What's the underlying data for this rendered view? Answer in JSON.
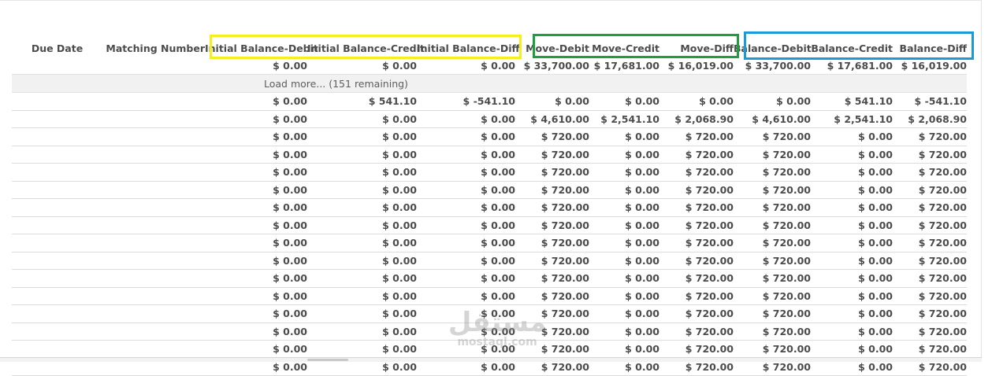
{
  "columns": {
    "due_date": "Due Date",
    "matching_number": "Matching Number",
    "initial_debit": "Initial Balance-Debit",
    "initial_credit": "Initial Balance-Credit",
    "initial_diff": "Initial Balance-Diff",
    "move_debit": "Move-Debit",
    "move_credit": "Move-Credit",
    "move_diff": "Move-Diff",
    "balance_debit": "Balance-Debit",
    "balance_credit": "Balance-Credit",
    "balance_diff": "Balance-Diff"
  },
  "totals": [
    "$ 0.00",
    "$ 0.00",
    "$ 0.00",
    "$ 33,700.00",
    "$ 17,681.00",
    "$ 16,019.00",
    "$ 33,700.00",
    "$ 17,681.00",
    "$ 16,019.00"
  ],
  "load_more": "Load more... (151 remaining)",
  "rows": [
    [
      "$ 0.00",
      "$ 541.10",
      "$ -541.10",
      "$ 0.00",
      "$ 0.00",
      "$ 0.00",
      "$ 0.00",
      "$ 541.10",
      "$ -541.10"
    ],
    [
      "$ 0.00",
      "$ 0.00",
      "$ 0.00",
      "$ 4,610.00",
      "$ 2,541.10",
      "$ 2,068.90",
      "$ 4,610.00",
      "$ 2,541.10",
      "$ 2,068.90"
    ],
    [
      "$ 0.00",
      "$ 0.00",
      "$ 0.00",
      "$ 720.00",
      "$ 0.00",
      "$ 720.00",
      "$ 720.00",
      "$ 0.00",
      "$ 720.00"
    ],
    [
      "$ 0.00",
      "$ 0.00",
      "$ 0.00",
      "$ 720.00",
      "$ 0.00",
      "$ 720.00",
      "$ 720.00",
      "$ 0.00",
      "$ 720.00"
    ],
    [
      "$ 0.00",
      "$ 0.00",
      "$ 0.00",
      "$ 720.00",
      "$ 0.00",
      "$ 720.00",
      "$ 720.00",
      "$ 0.00",
      "$ 720.00"
    ],
    [
      "$ 0.00",
      "$ 0.00",
      "$ 0.00",
      "$ 720.00",
      "$ 0.00",
      "$ 720.00",
      "$ 720.00",
      "$ 0.00",
      "$ 720.00"
    ],
    [
      "$ 0.00",
      "$ 0.00",
      "$ 0.00",
      "$ 720.00",
      "$ 0.00",
      "$ 720.00",
      "$ 720.00",
      "$ 0.00",
      "$ 720.00"
    ],
    [
      "$ 0.00",
      "$ 0.00",
      "$ 0.00",
      "$ 720.00",
      "$ 0.00",
      "$ 720.00",
      "$ 720.00",
      "$ 0.00",
      "$ 720.00"
    ],
    [
      "$ 0.00",
      "$ 0.00",
      "$ 0.00",
      "$ 720.00",
      "$ 0.00",
      "$ 720.00",
      "$ 720.00",
      "$ 0.00",
      "$ 720.00"
    ],
    [
      "$ 0.00",
      "$ 0.00",
      "$ 0.00",
      "$ 720.00",
      "$ 0.00",
      "$ 720.00",
      "$ 720.00",
      "$ 0.00",
      "$ 720.00"
    ],
    [
      "$ 0.00",
      "$ 0.00",
      "$ 0.00",
      "$ 720.00",
      "$ 0.00",
      "$ 720.00",
      "$ 720.00",
      "$ 0.00",
      "$ 720.00"
    ],
    [
      "$ 0.00",
      "$ 0.00",
      "$ 0.00",
      "$ 720.00",
      "$ 0.00",
      "$ 720.00",
      "$ 720.00",
      "$ 0.00",
      "$ 720.00"
    ],
    [
      "$ 0.00",
      "$ 0.00",
      "$ 0.00",
      "$ 720.00",
      "$ 0.00",
      "$ 720.00",
      "$ 720.00",
      "$ 0.00",
      "$ 720.00"
    ],
    [
      "$ 0.00",
      "$ 0.00",
      "$ 0.00",
      "$ 720.00",
      "$ 0.00",
      "$ 720.00",
      "$ 720.00",
      "$ 0.00",
      "$ 720.00"
    ],
    [
      "$ 0.00",
      "$ 0.00",
      "$ 0.00",
      "$ 720.00",
      "$ 0.00",
      "$ 720.00",
      "$ 720.00",
      "$ 0.00",
      "$ 720.00"
    ],
    [
      "$ 0.00",
      "$ 0.00",
      "$ 0.00",
      "$ 720.00",
      "$ 0.00",
      "$ 720.00",
      "$ 720.00",
      "$ 0.00",
      "$ 720.00"
    ]
  ],
  "highlights": {
    "initial_color": "#f5ef1f",
    "move_color": "#1e9e3c",
    "balance_color": "#1a9bd7"
  },
  "watermark": {
    "arabic": "مستقل",
    "latin": "mostaql.com"
  }
}
